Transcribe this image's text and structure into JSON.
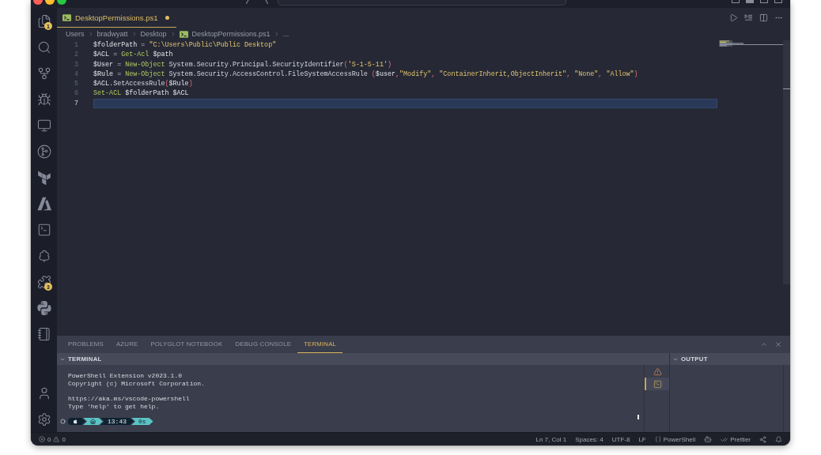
{
  "activity_bar": {
    "top": [
      {
        "kind": "files",
        "badge": "1"
      },
      {
        "kind": "search"
      },
      {
        "kind": "source-control"
      },
      {
        "kind": "debug"
      },
      {
        "kind": "remote"
      },
      {
        "kind": "git-graph"
      },
      {
        "kind": "terraform"
      },
      {
        "kind": "azure"
      },
      {
        "kind": "terminal"
      },
      {
        "kind": "testing"
      },
      {
        "kind": "extensions",
        "badge": "3"
      },
      {
        "kind": "python"
      },
      {
        "kind": "notebook"
      }
    ],
    "bottom": [
      {
        "kind": "account"
      },
      {
        "kind": "settings"
      }
    ]
  },
  "editor": {
    "tabs": [
      {
        "label": "DesktopPermissions.ps1",
        "selected": true,
        "modified": true
      }
    ],
    "breadcrumb": [
      {
        "kind": "folder",
        "label": "Users"
      },
      {
        "kind": "folder",
        "label": "bradwyatt"
      },
      {
        "kind": "folder",
        "label": "Desktop"
      },
      {
        "kind": "file",
        "label": "DesktopPermissions.ps1"
      },
      {
        "kind": "more",
        "label": "..."
      }
    ],
    "lines": [
      {
        "number": "1",
        "selected": false,
        "tokens": [
          {
            "kind": "variable",
            "text": "$folderPath"
          },
          {
            "kind": "operator",
            "text": " = "
          },
          {
            "kind": "string",
            "text": "\"C:\\Users\\Public\\Public Desktop\""
          }
        ]
      },
      {
        "number": "2",
        "selected": false,
        "tokens": [
          {
            "kind": "variable",
            "text": "$ACL"
          },
          {
            "kind": "operator",
            "text": " = "
          },
          {
            "kind": "command",
            "text": "Get-Acl"
          },
          {
            "kind": "variable",
            "text": " $path"
          }
        ]
      },
      {
        "number": "3",
        "selected": false,
        "tokens": [
          {
            "kind": "variable",
            "text": "$User"
          },
          {
            "kind": "operator",
            "text": " = "
          },
          {
            "kind": "command",
            "text": "New-Object"
          },
          {
            "kind": "type",
            "text": " System.Security.Principal.SecurityIdentifier"
          },
          {
            "kind": "punct",
            "text": "("
          },
          {
            "kind": "string",
            "text": "'S-1-5-11'"
          },
          {
            "kind": "punct",
            "text": ")"
          }
        ]
      },
      {
        "number": "4",
        "selected": false,
        "tokens": [
          {
            "kind": "variable",
            "text": "$Rule"
          },
          {
            "kind": "operator",
            "text": " = "
          },
          {
            "kind": "command",
            "text": "New-Object"
          },
          {
            "kind": "type",
            "text": " System.Security.AccessControl.FileSystemAccessRule "
          },
          {
            "kind": "punct",
            "text": "("
          },
          {
            "kind": "variable",
            "text": "$user"
          },
          {
            "kind": "punct",
            "text": ","
          },
          {
            "kind": "string",
            "text": "\"Modify\""
          },
          {
            "kind": "punct",
            "text": ", "
          },
          {
            "kind": "string",
            "text": "\"ContainerInherit,ObjectInherit\""
          },
          {
            "kind": "punct",
            "text": ", "
          },
          {
            "kind": "string",
            "text": "\"None\""
          },
          {
            "kind": "punct",
            "text": ", "
          },
          {
            "kind": "string",
            "text": "\"Allow\""
          },
          {
            "kind": "punct",
            "text": ")"
          }
        ]
      },
      {
        "number": "5",
        "selected": false,
        "tokens": [
          {
            "kind": "variable",
            "text": "$ACL"
          },
          {
            "kind": "member",
            "text": ".SetAccessRule"
          },
          {
            "kind": "punct",
            "text": "("
          },
          {
            "kind": "variable",
            "text": "$Rule"
          },
          {
            "kind": "punct",
            "text": ")"
          }
        ]
      },
      {
        "number": "6",
        "selected": false,
        "tokens": [
          {
            "kind": "command",
            "text": "Set-ACL"
          },
          {
            "kind": "variable",
            "text": " $folderPath $ACL"
          }
        ]
      },
      {
        "number": "7",
        "selected": true
      }
    ]
  },
  "panel": {
    "tabs": [
      {
        "label": "PROBLEMS",
        "selected": false
      },
      {
        "label": "AZURE",
        "selected": false
      },
      {
        "label": "POLYGLOT NOTEBOOK",
        "selected": false
      },
      {
        "label": "DEBUG CONSOLE",
        "selected": false
      },
      {
        "label": "TERMINAL",
        "selected": true
      }
    ],
    "terminal": {
      "title": "TERMINAL",
      "expanded": true,
      "blocks": [
        [
          "PowerShell Extension v2023.1.0",
          "Copyright (c) Microsoft Corporation."
        ],
        [
          "https://aka.ms/vscode-powershell",
          "Type 'help' to get help."
        ]
      ],
      "prompt": [
        {
          "kind": "apple",
          "color": "#0f2231"
        },
        {
          "kind": "home",
          "color": "#5cc3c5"
        },
        {
          "kind": "text",
          "text": "13:43",
          "color": "#0f2231"
        },
        {
          "kind": "text",
          "text": "0s",
          "color": "#5cc3c5"
        }
      ],
      "instances": [
        {
          "kind": "warning",
          "selected": false
        },
        {
          "kind": "terminal",
          "selected": true
        }
      ]
    },
    "output": {
      "title": "OUTPUT",
      "expanded": true
    }
  },
  "status_bar": {
    "problems": {
      "errors": "0",
      "warnings": "0"
    },
    "items": [
      {
        "kind": "text",
        "text": "Ln 7, Col 1"
      },
      {
        "kind": "text",
        "text": "Spaces: 4"
      },
      {
        "kind": "text",
        "text": "UTF-8"
      },
      {
        "kind": "text",
        "text": "LF"
      },
      {
        "kind": "language",
        "text": "PowerShell"
      },
      {
        "kind": "copilot"
      },
      {
        "kind": "formatter",
        "text": "Prettier"
      },
      {
        "kind": "share"
      },
      {
        "kind": "notifications"
      }
    ]
  }
}
